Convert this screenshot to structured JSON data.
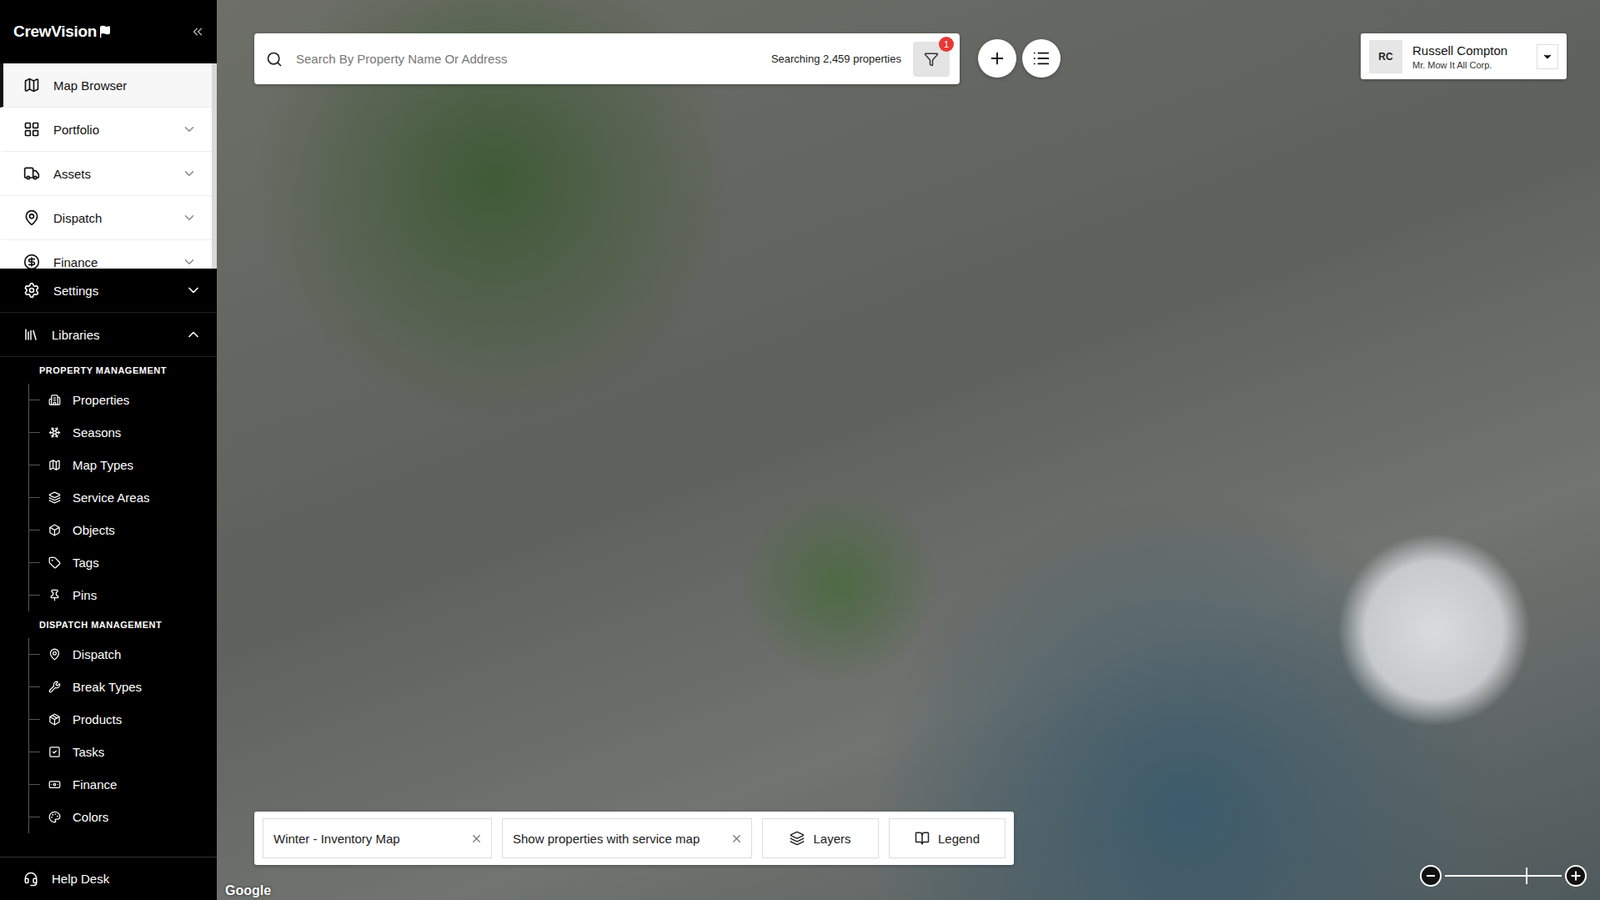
{
  "app": {
    "logo": "CrewVision"
  },
  "sidebar": {
    "nav": [
      {
        "label": "Map Browser",
        "selected": true,
        "expandable": false,
        "expanded": false
      },
      {
        "label": "Portfolio",
        "selected": false,
        "expandable": true,
        "expanded": false
      },
      {
        "label": "Assets",
        "selected": false,
        "expandable": true,
        "expanded": false
      },
      {
        "label": "Dispatch",
        "selected": false,
        "expandable": true,
        "expanded": false
      },
      {
        "label": "Finance",
        "selected": false,
        "expandable": true,
        "expanded": false
      }
    ],
    "settings": {
      "label": "Settings",
      "expanded": false
    },
    "libraries": {
      "label": "Libraries",
      "expanded": true
    },
    "groups": [
      {
        "title": "PROPERTY MANAGEMENT",
        "items": [
          "Properties",
          "Seasons",
          "Map Types",
          "Service Areas",
          "Objects",
          "Tags",
          "Pins"
        ]
      },
      {
        "title": "DISPATCH MANAGEMENT",
        "items": [
          "Dispatch",
          "Break Types",
          "Products",
          "Tasks",
          "Finance",
          "Colors"
        ]
      }
    ],
    "help": "Help Desk"
  },
  "search": {
    "placeholder": "Search By Property Name Or Address",
    "count": "Searching 2,459 properties",
    "filter_badge": "1"
  },
  "user": {
    "initials": "RC",
    "name": "Russell Compton",
    "company": "Mr. Mow It All Corp."
  },
  "map": {
    "attribution": "Google"
  },
  "bottom_bar": {
    "map_type": "Winter - Inventory Map",
    "filter": "Show properties with service map",
    "layers": "Layers",
    "legend": "Legend"
  },
  "zoom": {
    "level": 0.69
  }
}
